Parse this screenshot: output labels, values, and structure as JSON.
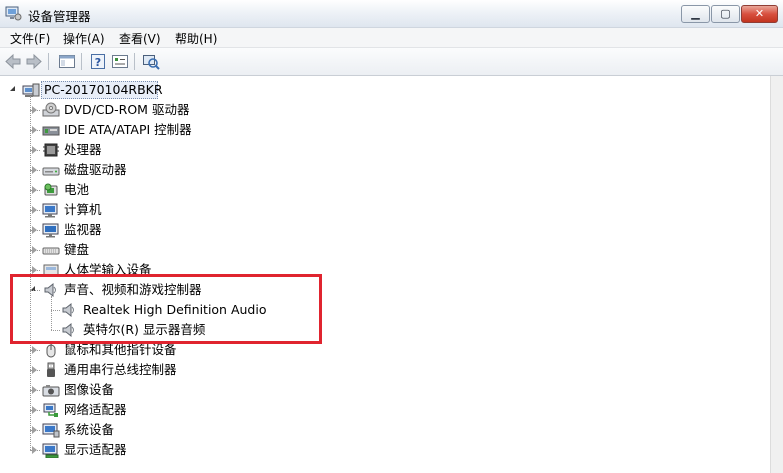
{
  "window": {
    "title": "设备管理器",
    "minimize_glyph": "▁",
    "maximize_glyph": "▢",
    "close_glyph": "✕"
  },
  "menu": [
    "文件(F)",
    "操作(A)",
    "查看(V)",
    "帮助(H)"
  ],
  "toolbar": {
    "buttons": [
      "back-arrow-icon",
      "forward-arrow-icon",
      "console-tree-icon",
      "help-icon",
      "properties-icon",
      "scan-hardware-icon"
    ]
  },
  "tree": {
    "root": "PC-20170104RBKR",
    "categories": [
      {
        "label": "DVD/CD-ROM 驱动器",
        "icon": "dvd-drive-icon"
      },
      {
        "label": "IDE ATA/ATAPI 控制器",
        "icon": "ide-controller-icon"
      },
      {
        "label": "处理器",
        "icon": "processor-icon"
      },
      {
        "label": "磁盘驱动器",
        "icon": "disk-drive-icon"
      },
      {
        "label": "电池",
        "icon": "battery-icon"
      },
      {
        "label": "计算机",
        "icon": "computer-icon"
      },
      {
        "label": "监视器",
        "icon": "monitor-icon"
      },
      {
        "label": "键盘",
        "icon": "keyboard-icon"
      },
      {
        "label": "人体学输入设备",
        "icon": "hid-icon"
      },
      {
        "label": "声音、视频和游戏控制器",
        "icon": "speaker-icon",
        "expanded": true,
        "children": [
          {
            "label": "Realtek High Definition Audio",
            "icon": "speaker-icon"
          },
          {
            "label": "英特尔(R) 显示器音频",
            "icon": "speaker-icon"
          }
        ]
      },
      {
        "label": "鼠标和其他指针设备",
        "icon": "mouse-icon"
      },
      {
        "label": "通用串行总线控制器",
        "icon": "usb-icon"
      },
      {
        "label": "图像设备",
        "icon": "camera-icon"
      },
      {
        "label": "网络适配器",
        "icon": "network-adapter-icon"
      },
      {
        "label": "系统设备",
        "icon": "system-device-icon"
      },
      {
        "label": "显示适配器",
        "icon": "display-adapter-icon"
      }
    ]
  },
  "colors": {
    "highlight": "#e0242f"
  }
}
